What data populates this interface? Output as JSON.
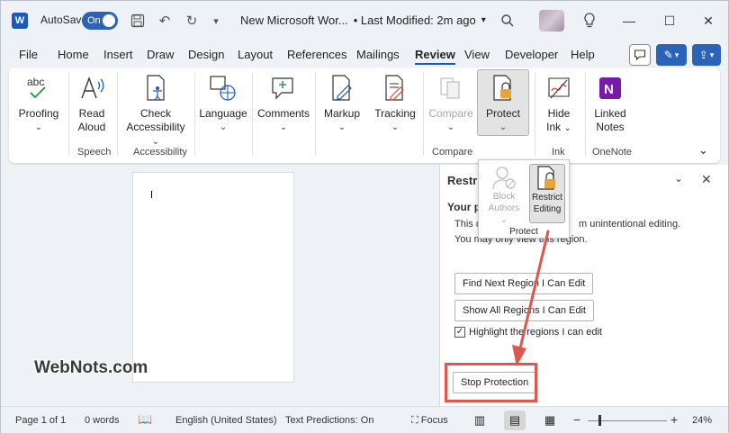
{
  "titlebar": {
    "logo": "W",
    "autosave_label": "AutoSave",
    "autosave_state": "On",
    "doc_title": "New Microsoft Wor...",
    "modified": "• Last Modified: 2m ago",
    "icons": [
      "save-icon",
      "undo-icon",
      "redo-icon",
      "customize-icon",
      "search-icon",
      "lightbulb-icon",
      "minimize-icon",
      "maximize-icon",
      "close-icon"
    ]
  },
  "menu": {
    "items": [
      "File",
      "Home",
      "Insert",
      "Draw",
      "Design",
      "Layout",
      "References",
      "Mailings",
      "Review",
      "View",
      "Developer",
      "Help"
    ],
    "active": "Review"
  },
  "ribbon": {
    "proofing": "Proofing",
    "read_aloud_1": "Read",
    "read_aloud_2": "Aloud",
    "speech": "Speech",
    "check_1": "Check",
    "check_2": "Accessibility",
    "accessibility": "Accessibility",
    "language": "Language",
    "comments": "Comments",
    "markup": "Markup",
    "tracking": "Tracking",
    "compare": "Compare",
    "compare_group": "Compare",
    "protect": "Protect",
    "hide_ink_1": "Hide",
    "hide_ink_2": "Ink",
    "ink_group": "Ink",
    "linked_1": "Linked",
    "linked_2": "Notes",
    "onenote_group": "OneNote",
    "proofing_icon_text": "abc"
  },
  "popup": {
    "block_1": "Block",
    "block_2": "Authors",
    "restrict_1": "Restrict",
    "restrict_2": "Editing",
    "group_label": "Protect"
  },
  "pane": {
    "title": "Restri",
    "subtitle": "Your p",
    "line1_a": "This d",
    "line1_b": "m unintentional editing.",
    "line2": "You may only view this region.",
    "find_next": "Find Next Region I Can Edit",
    "show_all": "Show All Regions I Can Edit",
    "highlight": "Highlight the regions I can edit",
    "stop": "Stop Protection"
  },
  "watermark": "WebNots.com",
  "status": {
    "page": "Page 1 of 1",
    "words": "0 words",
    "language": "English (United States)",
    "predictions": "Text Predictions: On",
    "focus": "Focus",
    "zoom_minus": "−",
    "zoom_plus": "+",
    "zoom": "24%",
    "zoom_level": 0.24
  },
  "colors": {
    "accent": "#185abd",
    "toggle": "#2b63b8",
    "highlight": "#e0564f",
    "onenote": "#7719aa"
  }
}
